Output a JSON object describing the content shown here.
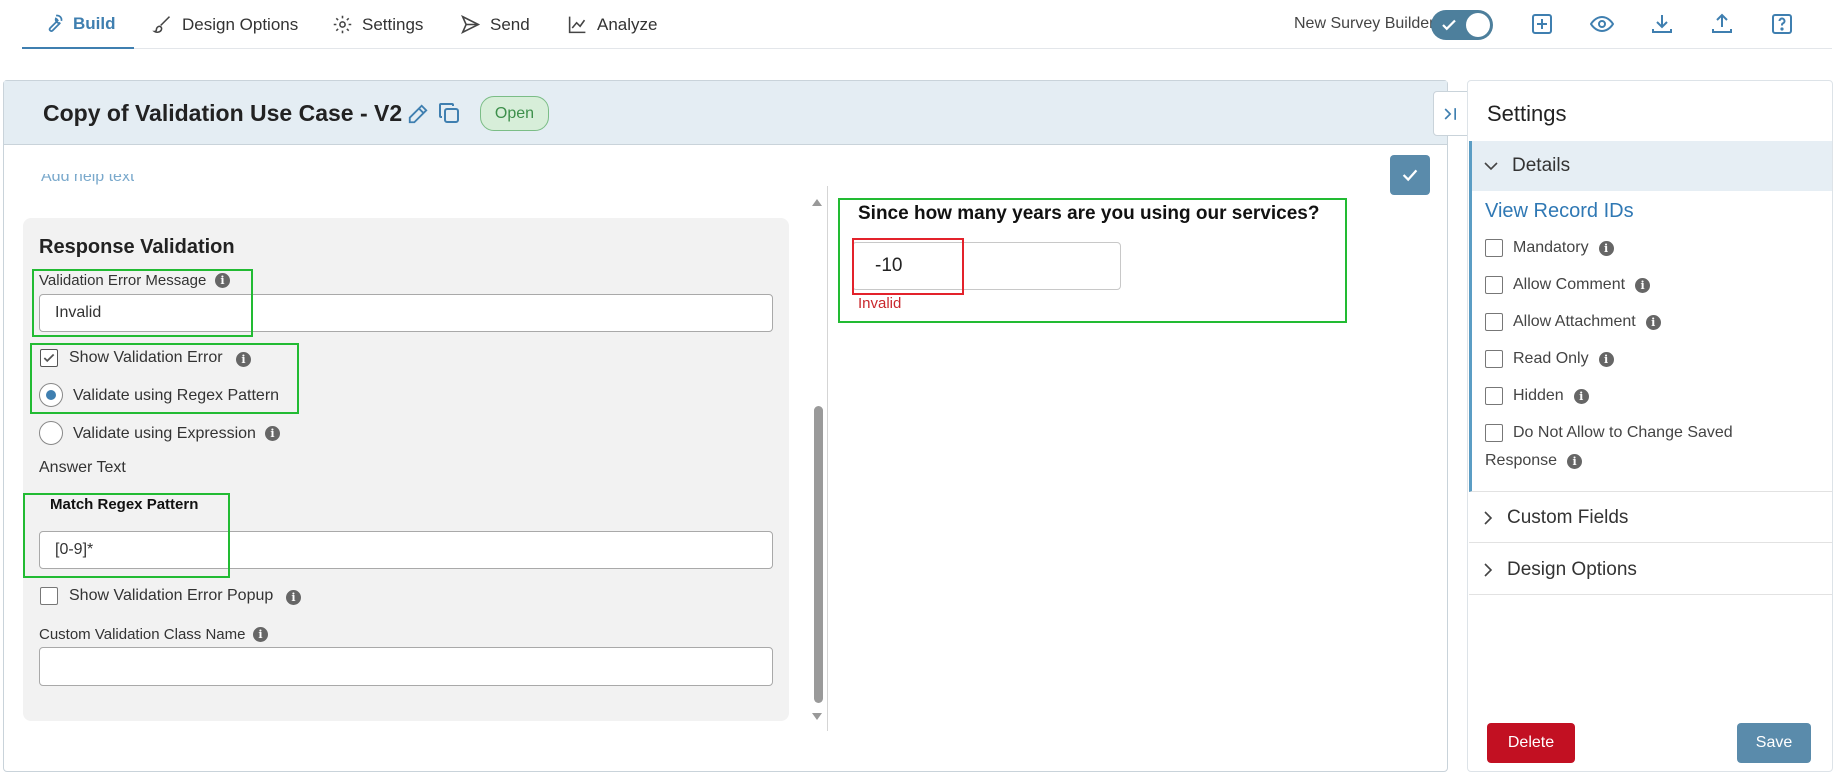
{
  "nav": {
    "tabs": [
      {
        "label": "Build",
        "icon": "wrench-icon"
      },
      {
        "label": "Design Options",
        "icon": "brush-icon"
      },
      {
        "label": "Settings",
        "icon": "gear-icon"
      },
      {
        "label": "Send",
        "icon": "send-icon"
      },
      {
        "label": "Analyze",
        "icon": "chart-line-icon"
      }
    ],
    "active_tab": "Build",
    "new_survey_builder_label": "New Survey Builder",
    "new_survey_builder_on": true,
    "right_icons": [
      "add-icon",
      "eye-icon",
      "download-icon",
      "upload-icon",
      "help-icon"
    ]
  },
  "survey": {
    "title": "Copy of Validation Use Case - V2",
    "status": "Open"
  },
  "editor": {
    "help_text": "Add help text",
    "response_validation": {
      "heading": "Response Validation",
      "error_message_label": "Validation Error Message",
      "error_message_value": "Invalid",
      "show_validation_error_label": "Show Validation Error",
      "show_validation_error_checked": true,
      "regex_option_label": "Validate using Regex Pattern",
      "expression_option_label": "Validate using Expression",
      "selected_option": "regex",
      "answer_text_label": "Answer Text",
      "match_regex_label": "Match Regex Pattern",
      "regex_value": "[0-9]*",
      "show_popup_label": "Show Validation Error Popup",
      "show_popup_checked": false,
      "custom_class_label": "Custom Validation Class Name",
      "custom_class_value": ""
    }
  },
  "preview": {
    "question": "Since how many years are you using our services?",
    "answer": "-10",
    "error": "Invalid"
  },
  "settings": {
    "title": "Settings",
    "details_label": "Details",
    "view_record_ids": "View Record IDs",
    "options": [
      {
        "label": "Mandatory",
        "checked": false
      },
      {
        "label": "Allow Comment",
        "checked": false
      },
      {
        "label": "Allow Attachment",
        "checked": false
      },
      {
        "label": "Read Only",
        "checked": false
      },
      {
        "label": "Hidden",
        "checked": false
      }
    ],
    "last_option_line1": "Do Not Allow to Change Saved",
    "last_option_line2": "Response",
    "custom_fields_label": "Custom Fields",
    "design_options_label": "Design Options",
    "delete_label": "Delete",
    "save_label": "Save"
  },
  "colors": {
    "accent": "#3f7fb0",
    "highlight_green": "#22bb33",
    "highlight_red": "#e3222b",
    "danger": "#c21022",
    "primary_button": "#5a8bab"
  }
}
